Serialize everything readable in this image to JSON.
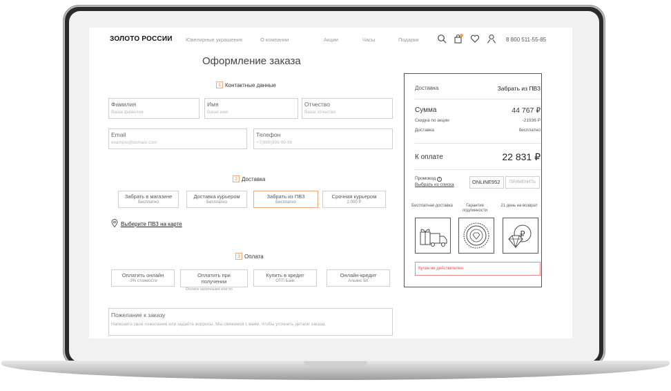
{
  "header": {
    "logo": "ЗОЛОТО РОССИИ",
    "nav": [
      "Ювелирные украшения",
      "О компании",
      "Акции",
      "Часы",
      "Подарки"
    ],
    "cart_count": "0",
    "phone": "8 800 511-55-85",
    "icons": [
      "search-icon",
      "cart-icon",
      "heart-icon",
      "user-icon"
    ]
  },
  "page_title": "Оформление заказа",
  "contacts": {
    "number": "1",
    "heading": "Контактные данные",
    "fields": [
      {
        "label": "Фамилия",
        "placeholder": "Ваша фамилия"
      },
      {
        "label": "Имя",
        "placeholder": "Ваше имя"
      },
      {
        "label": "Отчество",
        "placeholder": "Ваше отчество"
      },
      {
        "label": "Email",
        "placeholder": "example@domain.com"
      },
      {
        "label": "Телефон",
        "placeholder": "+7(999)999-99-99"
      }
    ]
  },
  "delivery": {
    "number": "2",
    "heading": "Доставка",
    "options": [
      {
        "title": "Забрать в магазине",
        "sub": "Бесплатно"
      },
      {
        "title": "Доставка курьером",
        "sub": "Бесплатно"
      },
      {
        "title": "Забрать из ПВЗ",
        "sub": "Бесплатно",
        "selected": true
      },
      {
        "title": "Срочная курьером",
        "sub": "2.000 Р"
      }
    ],
    "map_link": "Выберите ПВЗ на карте"
  },
  "payment": {
    "number": "3",
    "heading": "Оплата",
    "options": [
      {
        "title": "Оплатить онлайн",
        "sub": "-3% стоимости"
      },
      {
        "title": "Оплатить при получении",
        "sub": ""
      },
      {
        "title": "Купить в кредит",
        "sub": "ОТП Банк"
      },
      {
        "title": "Онлайн-кредит",
        "sub": "Альянс БК"
      }
    ],
    "cash_note": "Оплата наличными или по"
  },
  "wish": {
    "label": "Пожелание к заказу",
    "placeholder": "Напишите свои пожелания или задайте вопросы. Мы свяжемся с вами, чтобы уточнить детали заказа."
  },
  "summary": {
    "delivery_label": "Доставка",
    "delivery_value": "Забрать из ПВЗ",
    "sum_label": "Сумма",
    "sum_value": "44 767 ₽",
    "discount_label": "Скидка по акции",
    "discount_value": "-21936 Р",
    "shipping_label": "Доставка",
    "shipping_value": "бесплатно",
    "total_label": "К оплате",
    "total_value": "22 831 ₽",
    "promo_label": "Промокод",
    "promo_link": "Выбрать из списка",
    "promo_value": "ONLINE952",
    "apply_label": "ПРИМЕНИТЬ",
    "features": [
      {
        "label": "Бесплатная доставка",
        "icon": "delivery-truck-icon"
      },
      {
        "label": "Гарантия подлинности",
        "icon": "guarantee-seal-icon"
      },
      {
        "label": "21 день на возврат",
        "icon": "return-diamond-icon"
      }
    ],
    "coupon_error": "Купон не действителен"
  },
  "colors": {
    "accent": "#e07b3b",
    "accent_border": "#f0a87a",
    "error": "#e05050"
  }
}
